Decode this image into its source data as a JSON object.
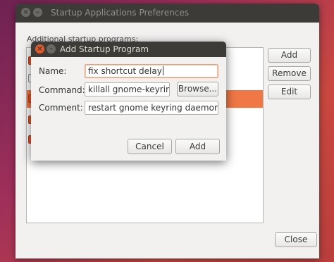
{
  "main_window": {
    "title": "Startup Applications Preferences",
    "section_label": "Additional startup programs:",
    "buttons": {
      "add": "Add",
      "remove": "Remove",
      "edit": "Edit",
      "close": "Close"
    },
    "rows": [
      {
        "checked": true,
        "selected": false
      },
      {
        "checked": false,
        "selected": false
      },
      {
        "checked": true,
        "selected": true
      },
      {
        "checked": true,
        "selected": false
      },
      {
        "checked": true,
        "selected": false
      }
    ],
    "window_controls": {
      "close": "×",
      "minimize": "–"
    }
  },
  "dialog": {
    "title": "Add Startup Program",
    "window_controls": {
      "close": "×",
      "minimize": "–"
    },
    "name_label": "Name:",
    "name_value": "fix shortcut delay",
    "command_label": "Command:",
    "command_value": "killall gnome-keyring-d",
    "browse_button": "Browse...",
    "comment_label": "Comment:",
    "comment_value": "restart gnome keyring daemon",
    "cancel_button": "Cancel",
    "add_button": "Add"
  },
  "colors": {
    "accent": "#f07746",
    "titlebar": "#3c3b37",
    "window_bg": "#f2f1f0"
  }
}
